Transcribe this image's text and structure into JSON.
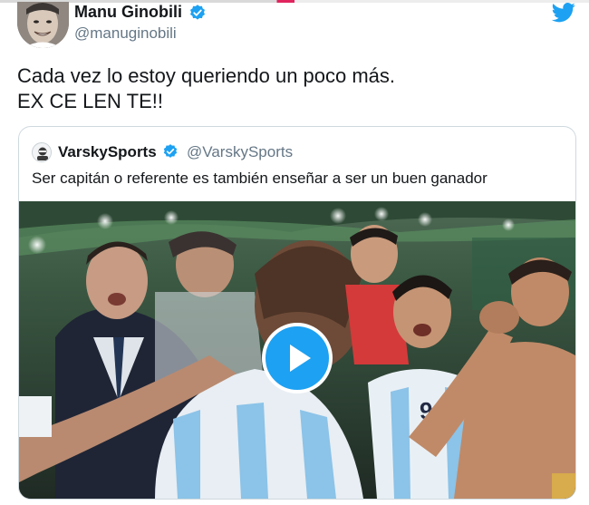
{
  "tweet": {
    "author_name": "Manu Ginobili",
    "author_handle": "@manuginobili",
    "text_lines": [
      "Cada vez lo estoy queriendo un poco más.",
      "EX CE LEN TE!!"
    ]
  },
  "quoted_tweet": {
    "author_name": "VarskySports",
    "author_handle": "@VarskySports",
    "text": "Ser capitán o referente es también enseñar a ser un buen ganador"
  },
  "icons": {
    "verified": "verified-badge-icon",
    "brand": "twitter-bird-icon",
    "play": "play-icon"
  },
  "colors": {
    "brand": "#1da1f2",
    "secondary_text": "#657786",
    "primary_text": "#14171a"
  }
}
